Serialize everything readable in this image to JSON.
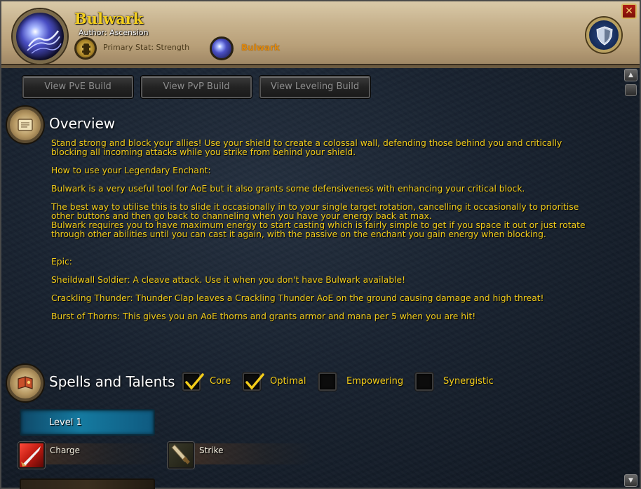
{
  "header": {
    "title": "Bulwark",
    "author": "Author: Ascension",
    "primary_stat": "Primary Stat: Strength",
    "talent_name": "Bulwark",
    "close_label": "✕",
    "spell_icon": "bulwark-spell-icon",
    "stat_icon": "strength-stat-icon",
    "emblem_icon": "shield-emblem-icon"
  },
  "builds": {
    "pve": "View PvE Build",
    "pvp": "View PvP Build",
    "leveling": "View Leveling Build"
  },
  "overview": {
    "title": "Overview",
    "paragraphs": [
      "Stand strong and block your allies! Use your shield to create a colossal wall, defending those behind you and critically blocking all incoming attacks while you strike from behind your shield.",
      "How to use your Legendary Enchant:",
      "Bulwark is a very useful tool for AoE but it also grants some defensiveness with enhancing your critical block.",
      "The best way to utilise this is to slide it occasionally in to your single target rotation, cancelling it occasionally to prioritise other buttons and then go back to channeling when you have your energy back at max.",
      "Bulwark requires you to have maximum energy to start casting which is fairly simple to get if you space it out or just rotate through other abilities until you can cast it again, with the passive on the enchant you gain energy when blocking.",
      "Epic:",
      "Sheildwall Soldier: A cleave attack. Use it when you don't have Bulwark available!",
      "Crackling Thunder: Thunder Clap leaves a Crackling Thunder AoE on the ground causing damage and high threat!",
      "Burst of Thorns: This gives you an AoE thorns and grants armor and mana per 5 when you are hit!"
    ]
  },
  "spells": {
    "title": "Spells and Talents",
    "filters": [
      {
        "label": "Core",
        "checked": true
      },
      {
        "label": "Optimal",
        "checked": true
      },
      {
        "label": "Empowering",
        "checked": false
      },
      {
        "label": "Synergistic",
        "checked": false
      }
    ],
    "level_label": "Level 1",
    "items": [
      {
        "label": "Charge",
        "icon": "charge-icon"
      },
      {
        "label": "Strike",
        "icon": "strike-icon"
      }
    ]
  },
  "colors": {
    "accent_text": "#f2cc1a",
    "title_gold": "#f5d020",
    "talent_orange": "#e08a10",
    "level_blue": "#157aa0"
  }
}
